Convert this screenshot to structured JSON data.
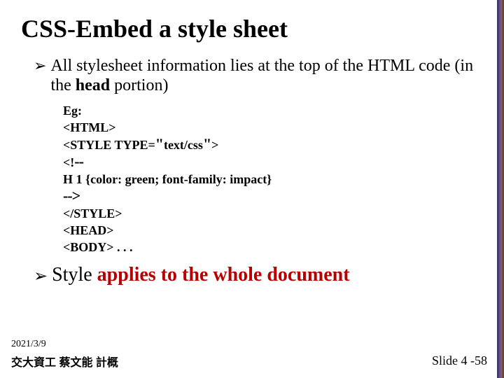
{
  "title": "CSS-Embed a style sheet",
  "bullet1": {
    "pre": "All stylesheet information lies at the top of the HTML code (in the ",
    "bold": "head",
    "post": " portion)"
  },
  "code": {
    "l1": "Eg:",
    "l2": "<HTML>",
    "l3a": "<STYLE TYPE=",
    "l3b": "text/css",
    "l3c": ">",
    "l4a": "<!",
    "l4b": "--",
    "l5": "H 1 {color: green; font-family: impact}",
    "l6": "-->",
    "l7": "</STYLE>",
    "l8": "<HEAD>",
    "l9": "<BODY> . . ."
  },
  "bullet2": {
    "pre": "Style ",
    "bold": "applies to the whole document"
  },
  "footer": {
    "date": "2021/3/9",
    "author": "交大資工 蔡文能 計概",
    "slide": "Slide 4 -58"
  }
}
